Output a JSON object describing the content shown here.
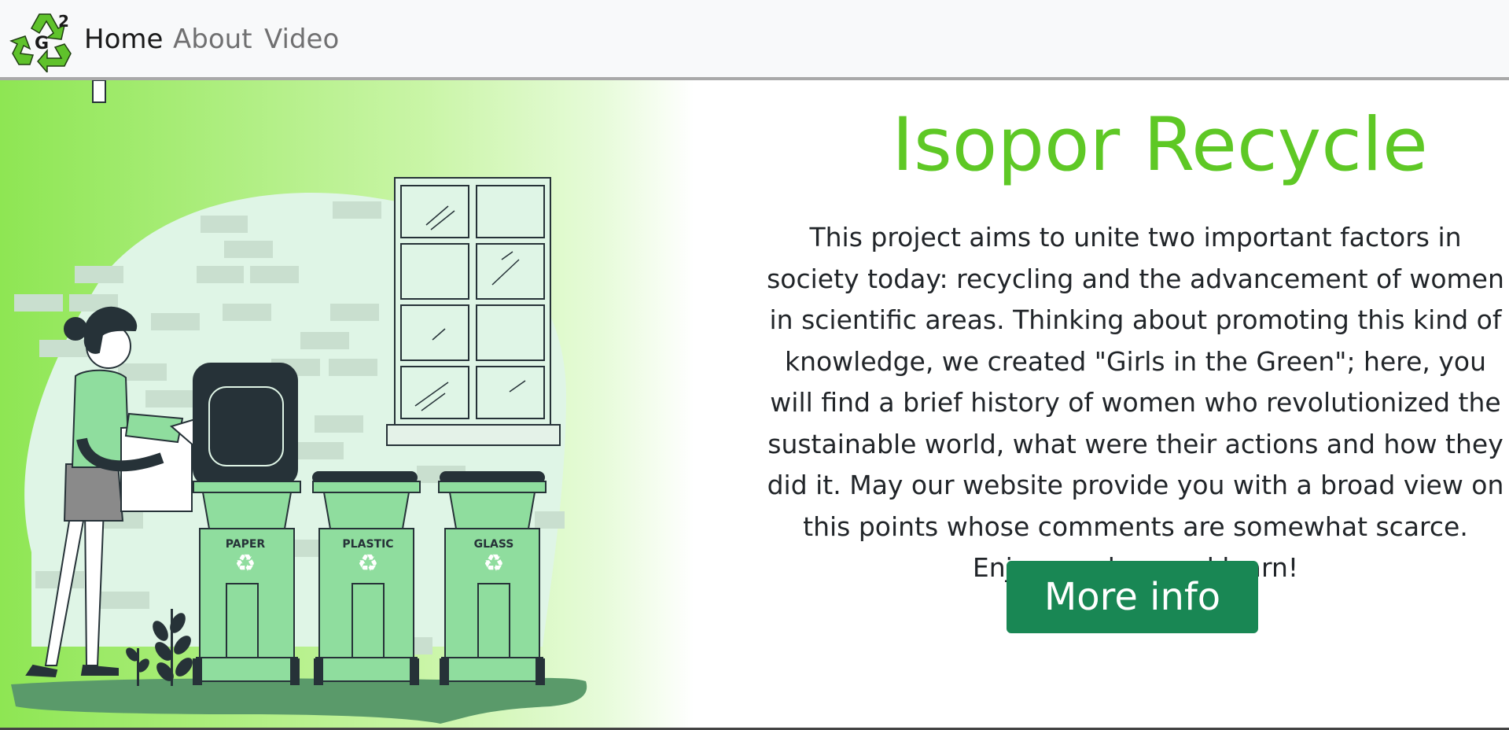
{
  "navbar": {
    "logo": {
      "letter": "G",
      "superscript": "2",
      "icon": "recycle-logo-icon"
    },
    "links": [
      {
        "label": "Home",
        "active": true
      },
      {
        "label": "About",
        "active": false
      },
      {
        "label": "Video",
        "active": false
      }
    ]
  },
  "hero": {
    "title": "Isopor Recycle",
    "description": "This project aims to unite two important factors in society today: recycling and the advancement of women in scientific areas. Thinking about promoting this kind of knowledge, we created \"Girls in the Green\"; here, you will find a brief history of women who revolutionized the sustainable world, what were their actions and how they did it. May our website provide you with a broad view on this points whose comments are somewhat scarce. Enjoy, explore and learn!",
    "button_label": "More info",
    "bins": [
      {
        "label": "PAPER"
      },
      {
        "label": "PLASTIC"
      },
      {
        "label": "GLASS"
      }
    ]
  },
  "colors": {
    "accent_green": "#5ec825",
    "button_green": "#198754",
    "bin_green": "#8fdd9e",
    "dark": "#263238"
  }
}
